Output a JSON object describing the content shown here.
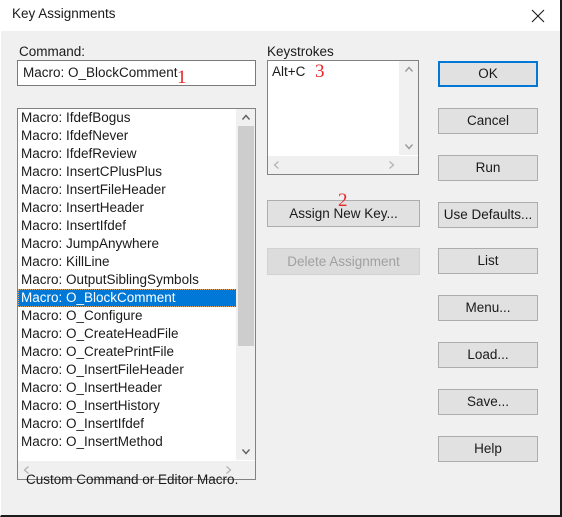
{
  "window": {
    "title": "Key Assignments",
    "close_icon": "close-icon"
  },
  "labels": {
    "command": "Command:",
    "keystrokes": "Keystrokes"
  },
  "command_input": {
    "value": "Macro: O_BlockComment",
    "placeholder": ""
  },
  "command_list": {
    "selected_index": 10,
    "items": [
      "Macro: IfdefBogus",
      "Macro: IfdefNever",
      "Macro: IfdefReview",
      "Macro: InsertCPlusPlus",
      "Macro: InsertFileHeader",
      "Macro: InsertHeader",
      "Macro: InsertIfdef",
      "Macro: JumpAnywhere",
      "Macro: KillLine",
      "Macro: OutputSiblingSymbols",
      "Macro: O_BlockComment",
      "Macro: O_Configure",
      "Macro: O_CreateHeadFile",
      "Macro: O_CreatePrintFile",
      "Macro: O_InsertFileHeader",
      "Macro: O_InsertHeader",
      "Macro: O_InsertHistory",
      "Macro: O_InsertIfdef",
      "Macro: O_InsertMethod"
    ],
    "scroll_up_icon": "chevron-up-icon",
    "scroll_down_icon": "chevron-down-icon",
    "scroll_left_icon": "chevron-left-icon",
    "scroll_right_icon": "chevron-right-icon"
  },
  "keystrokes_list": {
    "items": [
      "Alt+C"
    ],
    "scroll_up_icon": "chevron-up-icon",
    "scroll_down_icon": "chevron-down-icon",
    "scroll_left_icon": "chevron-left-icon",
    "scroll_right_icon": "chevron-right-icon"
  },
  "buttons": {
    "assign_new_key": "Assign New Key...",
    "delete_assignment": "Delete Assignment",
    "ok": "OK",
    "cancel": "Cancel",
    "run": "Run",
    "use_defaults": "Use Defaults...",
    "list": "List",
    "menu": "Menu...",
    "load": "Load...",
    "save": "Save...",
    "help": "Help"
  },
  "status": {
    "text": "Custom Command or Editor Macro."
  },
  "annotations": [
    {
      "id": "1",
      "label": "1"
    },
    {
      "id": "2",
      "label": "2"
    },
    {
      "id": "3",
      "label": "3"
    }
  ],
  "colors": {
    "dialog_background": "#f0f0f0",
    "selection": "#0078d7",
    "default_button_border": "#0078d7",
    "annotation": "#e8262a",
    "field_background": "#ffffff",
    "disabled_text": "#a0a0a0"
  }
}
